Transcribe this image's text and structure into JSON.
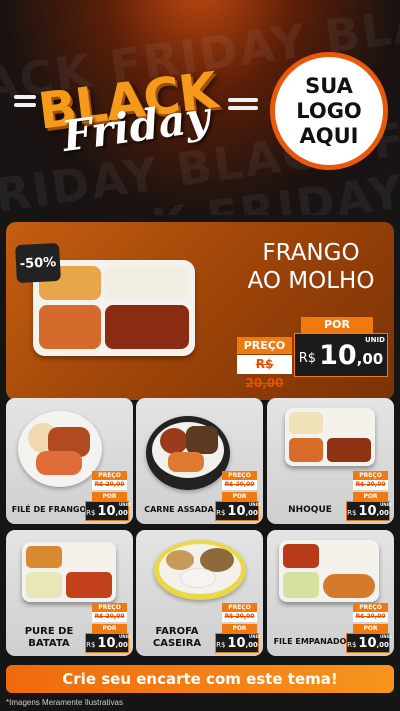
{
  "header": {
    "black_word": "BLACK",
    "friday_word": "Friday",
    "background_words": [
      "ACK FRIDAY BLACK",
      "FRIDAY BLACK FR",
      "K FRIDAY BLACK"
    ],
    "logo_lines": [
      "SUA",
      "LOGO",
      "AQUI"
    ]
  },
  "hero": {
    "discount": "-50%",
    "title_line1": "FRANGO",
    "title_line2": "AO MOLHO",
    "preco_label": "PREÇO",
    "old_price": "R$ 20,00",
    "por_label": "POR",
    "currency": "R$",
    "price_int": "10",
    "price_cents": ",00",
    "unit": "UNID"
  },
  "products": [
    {
      "name": "FILÉ DE FRANGO",
      "preco_label": "PREÇO",
      "old_price": "R$ 20,00",
      "por_label": "POR",
      "currency": "R$",
      "price_int": "10",
      "price_cents": ",00",
      "unit": "UNID"
    },
    {
      "name": "CARNE ASSADA",
      "preco_label": "PREÇO",
      "old_price": "R$ 20,00",
      "por_label": "POR",
      "currency": "R$",
      "price_int": "10",
      "price_cents": ",00",
      "unit": "UNID"
    },
    {
      "name": "NHOQUE",
      "preco_label": "PREÇO",
      "old_price": "R$ 20,00",
      "por_label": "POR",
      "currency": "R$",
      "price_int": "10",
      "price_cents": ",00",
      "unit": "UNID"
    },
    {
      "name": "PURE DE BATATA",
      "preco_label": "PREÇO",
      "old_price": "R$ 20,00",
      "por_label": "POR",
      "currency": "R$",
      "price_int": "10",
      "price_cents": ",00",
      "unit": "UNID"
    },
    {
      "name": "FAROFA CASEIRA",
      "preco_label": "PREÇO",
      "old_price": "R$ 20,00",
      "por_label": "POR",
      "currency": "R$",
      "price_int": "10",
      "price_cents": ",00",
      "unit": "UNID"
    },
    {
      "name": "FILE EMPANADO",
      "preco_label": "PREÇO",
      "old_price": "R$ 20,00",
      "por_label": "POR",
      "currency": "R$",
      "price_int": "10",
      "price_cents": ",00",
      "unit": "UNID"
    }
  ],
  "cta": "Crie seu encarte com este tema!",
  "disclaimer": "*Imagens Meramente Ilustrativas",
  "colors": {
    "accent": "#f07a10",
    "dark": "#151515",
    "hero_bg": "#9a4208",
    "card_bg": "#d9d9d9"
  }
}
